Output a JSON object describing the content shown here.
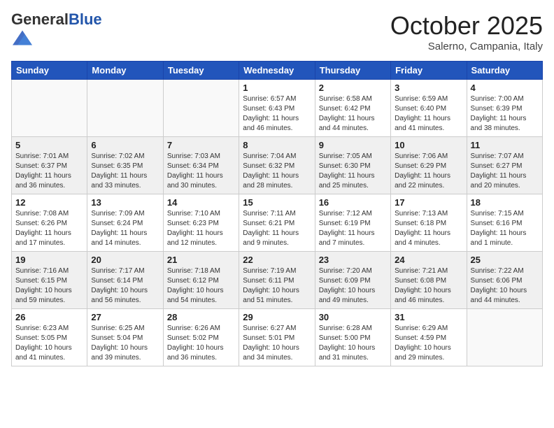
{
  "header": {
    "logo_general": "General",
    "logo_blue": "Blue",
    "month_title": "October 2025",
    "location": "Salerno, Campania, Italy"
  },
  "weekdays": [
    "Sunday",
    "Monday",
    "Tuesday",
    "Wednesday",
    "Thursday",
    "Friday",
    "Saturday"
  ],
  "weeks": [
    [
      {
        "day": "",
        "info": ""
      },
      {
        "day": "",
        "info": ""
      },
      {
        "day": "",
        "info": ""
      },
      {
        "day": "1",
        "info": "Sunrise: 6:57 AM\nSunset: 6:43 PM\nDaylight: 11 hours\nand 46 minutes."
      },
      {
        "day": "2",
        "info": "Sunrise: 6:58 AM\nSunset: 6:42 PM\nDaylight: 11 hours\nand 44 minutes."
      },
      {
        "day": "3",
        "info": "Sunrise: 6:59 AM\nSunset: 6:40 PM\nDaylight: 11 hours\nand 41 minutes."
      },
      {
        "day": "4",
        "info": "Sunrise: 7:00 AM\nSunset: 6:39 PM\nDaylight: 11 hours\nand 38 minutes."
      }
    ],
    [
      {
        "day": "5",
        "info": "Sunrise: 7:01 AM\nSunset: 6:37 PM\nDaylight: 11 hours\nand 36 minutes."
      },
      {
        "day": "6",
        "info": "Sunrise: 7:02 AM\nSunset: 6:35 PM\nDaylight: 11 hours\nand 33 minutes."
      },
      {
        "day": "7",
        "info": "Sunrise: 7:03 AM\nSunset: 6:34 PM\nDaylight: 11 hours\nand 30 minutes."
      },
      {
        "day": "8",
        "info": "Sunrise: 7:04 AM\nSunset: 6:32 PM\nDaylight: 11 hours\nand 28 minutes."
      },
      {
        "day": "9",
        "info": "Sunrise: 7:05 AM\nSunset: 6:30 PM\nDaylight: 11 hours\nand 25 minutes."
      },
      {
        "day": "10",
        "info": "Sunrise: 7:06 AM\nSunset: 6:29 PM\nDaylight: 11 hours\nand 22 minutes."
      },
      {
        "day": "11",
        "info": "Sunrise: 7:07 AM\nSunset: 6:27 PM\nDaylight: 11 hours\nand 20 minutes."
      }
    ],
    [
      {
        "day": "12",
        "info": "Sunrise: 7:08 AM\nSunset: 6:26 PM\nDaylight: 11 hours\nand 17 minutes."
      },
      {
        "day": "13",
        "info": "Sunrise: 7:09 AM\nSunset: 6:24 PM\nDaylight: 11 hours\nand 14 minutes."
      },
      {
        "day": "14",
        "info": "Sunrise: 7:10 AM\nSunset: 6:23 PM\nDaylight: 11 hours\nand 12 minutes."
      },
      {
        "day": "15",
        "info": "Sunrise: 7:11 AM\nSunset: 6:21 PM\nDaylight: 11 hours\nand 9 minutes."
      },
      {
        "day": "16",
        "info": "Sunrise: 7:12 AM\nSunset: 6:19 PM\nDaylight: 11 hours\nand 7 minutes."
      },
      {
        "day": "17",
        "info": "Sunrise: 7:13 AM\nSunset: 6:18 PM\nDaylight: 11 hours\nand 4 minutes."
      },
      {
        "day": "18",
        "info": "Sunrise: 7:15 AM\nSunset: 6:16 PM\nDaylight: 11 hours\nand 1 minute."
      }
    ],
    [
      {
        "day": "19",
        "info": "Sunrise: 7:16 AM\nSunset: 6:15 PM\nDaylight: 10 hours\nand 59 minutes."
      },
      {
        "day": "20",
        "info": "Sunrise: 7:17 AM\nSunset: 6:14 PM\nDaylight: 10 hours\nand 56 minutes."
      },
      {
        "day": "21",
        "info": "Sunrise: 7:18 AM\nSunset: 6:12 PM\nDaylight: 10 hours\nand 54 minutes."
      },
      {
        "day": "22",
        "info": "Sunrise: 7:19 AM\nSunset: 6:11 PM\nDaylight: 10 hours\nand 51 minutes."
      },
      {
        "day": "23",
        "info": "Sunrise: 7:20 AM\nSunset: 6:09 PM\nDaylight: 10 hours\nand 49 minutes."
      },
      {
        "day": "24",
        "info": "Sunrise: 7:21 AM\nSunset: 6:08 PM\nDaylight: 10 hours\nand 46 minutes."
      },
      {
        "day": "25",
        "info": "Sunrise: 7:22 AM\nSunset: 6:06 PM\nDaylight: 10 hours\nand 44 minutes."
      }
    ],
    [
      {
        "day": "26",
        "info": "Sunrise: 6:23 AM\nSunset: 5:05 PM\nDaylight: 10 hours\nand 41 minutes."
      },
      {
        "day": "27",
        "info": "Sunrise: 6:25 AM\nSunset: 5:04 PM\nDaylight: 10 hours\nand 39 minutes."
      },
      {
        "day": "28",
        "info": "Sunrise: 6:26 AM\nSunset: 5:02 PM\nDaylight: 10 hours\nand 36 minutes."
      },
      {
        "day": "29",
        "info": "Sunrise: 6:27 AM\nSunset: 5:01 PM\nDaylight: 10 hours\nand 34 minutes."
      },
      {
        "day": "30",
        "info": "Sunrise: 6:28 AM\nSunset: 5:00 PM\nDaylight: 10 hours\nand 31 minutes."
      },
      {
        "day": "31",
        "info": "Sunrise: 6:29 AM\nSunset: 4:59 PM\nDaylight: 10 hours\nand 29 minutes."
      },
      {
        "day": "",
        "info": ""
      }
    ]
  ]
}
